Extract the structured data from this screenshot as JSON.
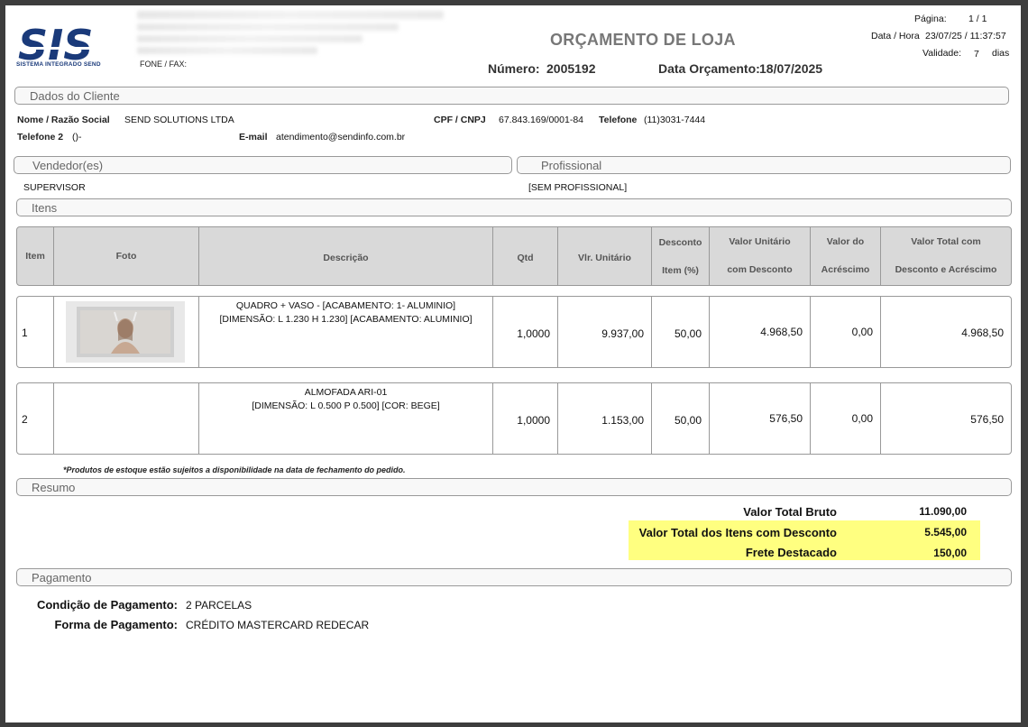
{
  "header": {
    "logo_text": "SIS",
    "logo_subtitle": "SISTEMA INTEGRADO SEND",
    "phone_label": "FONE / FAX:",
    "document_title": "ORÇAMENTO DE LOJA",
    "number_label": "Número:",
    "number_value": "2005192",
    "date_label": "Data Orçamento:",
    "date_value": "18/07/2025",
    "page_label": "Página:",
    "page_value": "1 / 1",
    "datetime_label": "Data / Hora",
    "datetime_value": "23/07/25 / 11:37:57",
    "validity_label": "Validade:",
    "validity_value": "7",
    "validity_unit": "dias"
  },
  "client": {
    "section_title": "Dados do Cliente",
    "name_label": "Nome / Razão Social",
    "name_value": "SEND SOLUTIONS LTDA",
    "cpf_label": "CPF / CNPJ",
    "cpf_value": "67.843.169/0001-84",
    "phone_label": "Telefone",
    "phone_value": "(11)3031-7444",
    "phone2_label": "Telefone 2",
    "phone2_value": "()-",
    "email_label": "E-mail",
    "email_value": "atendimento@sendinfo.com.br"
  },
  "sellers": {
    "section_title": "Vendedor(es)",
    "value": "SUPERVISOR"
  },
  "professional": {
    "section_title": "Profissional",
    "value": "[SEM PROFISSIONAL]"
  },
  "items_section": {
    "section_title": "Itens",
    "columns": {
      "item": "Item",
      "photo": "Foto",
      "description": "Descrição",
      "qty": "Qtd",
      "unit_price": "Vlr. Unitário",
      "discount_1": "Desconto",
      "discount_2": "Item (%)",
      "unit_disc_1": "Valor Unitário",
      "unit_disc_2": "com Desconto",
      "addition_1": "Valor do",
      "addition_2": "Acréscimo",
      "total_1": "Valor Total com",
      "total_2": "Desconto e Acréscimo"
    },
    "rows": [
      {
        "item": "1",
        "desc_line1": "QUADRO + VASO - [ACABAMENTO:   1- ALUMINIO]",
        "desc_line2": "[DIMENSÃO: L 1.230 H 1.230] [ACABAMENTO: ALUMINIO]",
        "qty": "1,0000",
        "unit_price": "9.937,00",
        "discount": "50,00",
        "unit_disc": "4.968,50",
        "addition": "0,00",
        "total": "4.968,50"
      },
      {
        "item": "2",
        "desc_line1": "ALMOFADA ARI-01",
        "desc_line2": "[DIMENSÃO: L 0.500 P 0.500] [COR: BEGE]",
        "qty": "1,0000",
        "unit_price": "1.153,00",
        "discount": "50,00",
        "unit_disc": "576,50",
        "addition": "0,00",
        "total": "576,50"
      }
    ],
    "note": "*Produtos de estoque estão sujeitos a disponibilidade na data de fechamento do pedido."
  },
  "summary": {
    "section_title": "Resumo",
    "gross_label": "Valor Total Bruto",
    "gross_value": "11.090,00",
    "discounted_label": "Valor Total dos Itens com Desconto",
    "discounted_value": "5.545,00",
    "freight_label": "Frete Destacado",
    "freight_value": "150,00",
    "highlight_color": "#ffff80"
  },
  "payment": {
    "section_title": "Pagamento",
    "condition_label": "Condição de Pagamento:",
    "condition_value": "2 PARCELAS",
    "method_label": "Forma de Pagamento:",
    "method_value": "CRÉDITO MASTERCARD REDECAR"
  },
  "colors": {
    "logo_blue": "#1a3a7a",
    "header_gray": "#d9d9d9",
    "border_gray": "#999999"
  }
}
